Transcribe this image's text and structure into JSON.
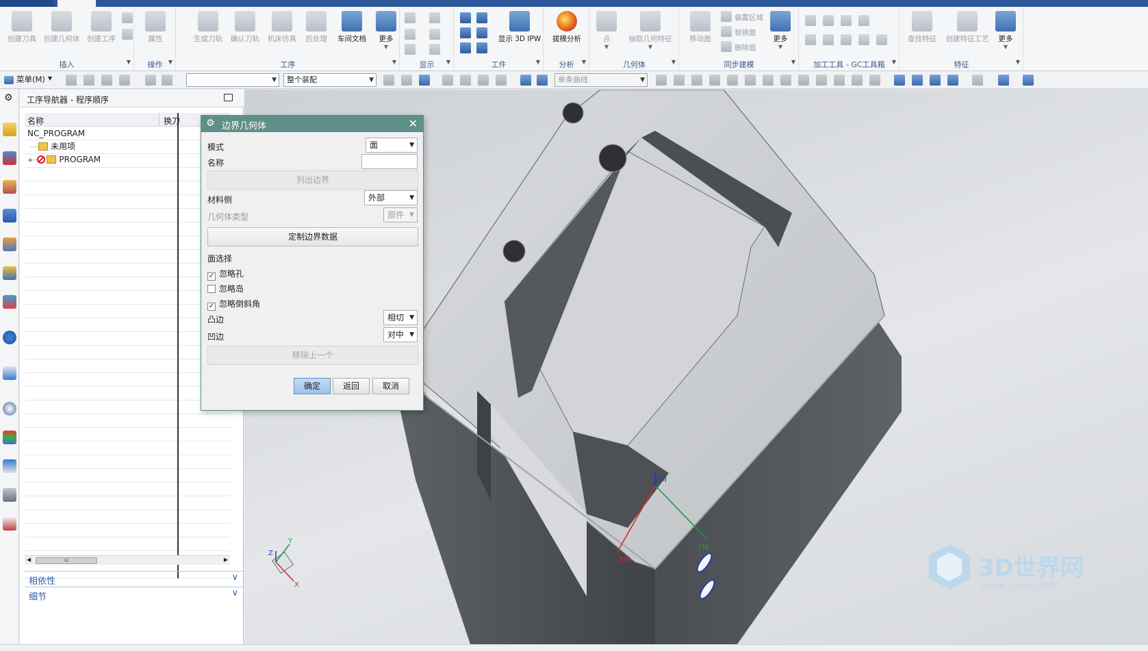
{
  "ribbon": {
    "groups": [
      {
        "label": "插入",
        "buttons": [
          "创建刀具",
          "创建几何体",
          "创建工序"
        ]
      },
      {
        "label": "操作",
        "buttons": [
          "属性"
        ]
      },
      {
        "label": "工序",
        "buttons": [
          "生成刀轨",
          "确认刀轨",
          "机床仿真",
          "后处理",
          "车间文档",
          "更多"
        ]
      },
      {
        "label": "显示",
        "buttons": []
      },
      {
        "label": "工件",
        "buttons": [
          "显示 3D IPW"
        ]
      },
      {
        "label": "分析",
        "buttons": [
          "拔模分析"
        ]
      },
      {
        "label": "几何体",
        "buttons": [
          "点",
          "抽取几何特征"
        ]
      },
      {
        "label": "同步建模",
        "buttons": [
          "移动面",
          "偏置区域",
          "替换面",
          "删除面",
          "更多"
        ]
      },
      {
        "label": "加工工具 - GC工具箱",
        "buttons": []
      },
      {
        "label": "特征",
        "buttons": [
          "查找特征",
          "创建特征工艺",
          "更多"
        ]
      }
    ]
  },
  "toolbar": {
    "menu_label": "菜单(M)",
    "filter_value": "",
    "assembly_value": "整个装配",
    "curve_rule_value": "单条曲线"
  },
  "navigator": {
    "title": "工序导航器 - 程序顺序",
    "col_name": "名称",
    "col_tool": "换刀",
    "root": "NC_PROGRAM",
    "unused": "未用项",
    "program": "PROGRAM",
    "sections": [
      "相依性",
      "细节"
    ],
    "scroll_thumb": "III"
  },
  "dialog": {
    "title": "边界几何体",
    "mode_label": "模式",
    "mode_value": "面",
    "name_label": "名称",
    "name_value": "",
    "list_boundary": "列出边界",
    "material_side_label": "材料侧",
    "material_side_value": "外部",
    "geom_type_label": "几何体类型",
    "geom_type_value": "部件",
    "custom_boundary": "定制边界数据",
    "face_select_label": "面选择",
    "ignore_holes": {
      "label": "忽略孔",
      "checked": true
    },
    "ignore_islands": {
      "label": "忽略岛",
      "checked": false
    },
    "ignore_chamfers": {
      "label": "忽略倒斜角",
      "checked": true
    },
    "convex_label": "凸边",
    "convex_value": "相切",
    "concave_label": "凹边",
    "concave_value": "对中",
    "remove_last": "移除上一个",
    "ok": "确定",
    "back": "返回",
    "cancel": "取消"
  },
  "viewport": {
    "csys_zm": "ZM",
    "csys_xm": "XM",
    "csys_ym": "YM",
    "triad_x": "X",
    "triad_y": "Y",
    "triad_z": "Z",
    "watermark": "3D世界网",
    "watermark_url": "WWW.3DSJW.COM"
  },
  "colors": {
    "ribbon_label": "#3a5a8c",
    "dialog_title_bg": "#5e8f88",
    "panel_section": "#2c5ea8",
    "part_dark": "#4a4d51",
    "part_light": "#c8cacd"
  }
}
